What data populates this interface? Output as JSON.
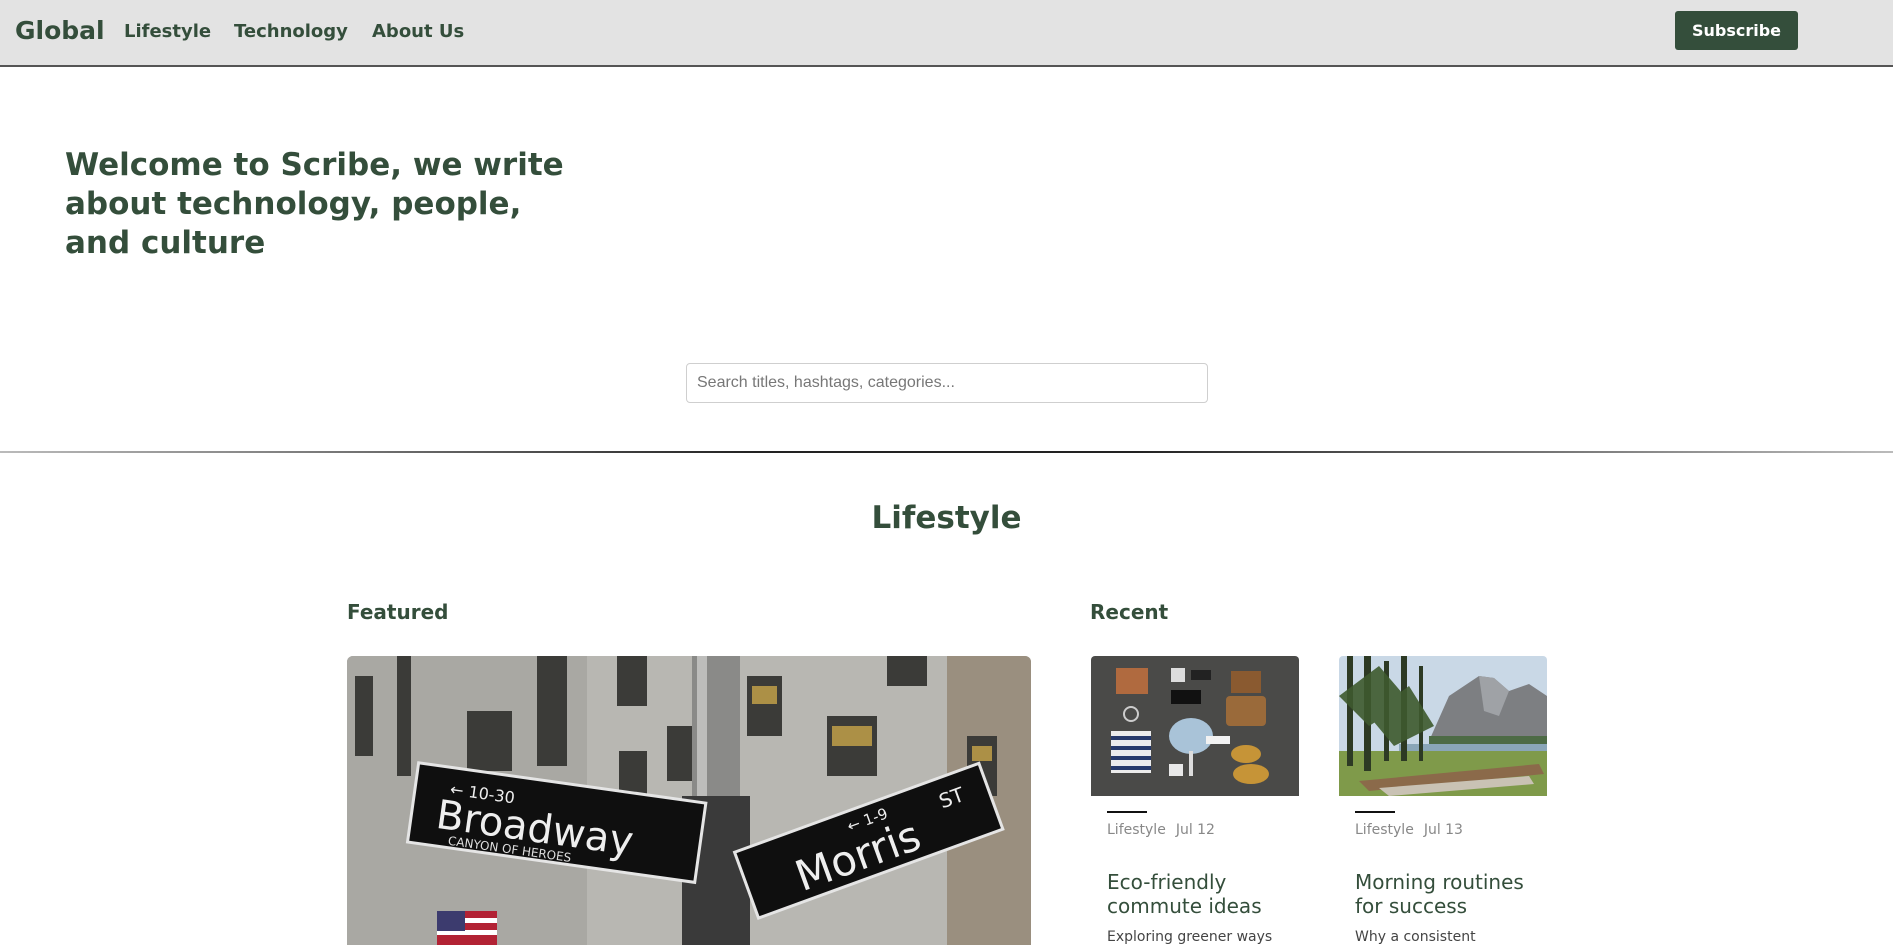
{
  "navbar": {
    "brand": "Global",
    "links": [
      "Lifestyle",
      "Technology",
      "About Us"
    ],
    "subscribe_label": "Subscribe"
  },
  "hero": {
    "title": "Welcome to Scribe, we write about technology, people, and culture",
    "search_placeholder": "Search titles, hashtags, categories..."
  },
  "section": {
    "title": "Lifestyle",
    "featured_label": "Featured",
    "recent_label": "Recent",
    "featured_image_signs": [
      "Broadway",
      "← 10-30",
      "CANYON OF HEROES",
      "Morris",
      "ST",
      "← 1-9"
    ],
    "cards": [
      {
        "category": "Lifestyle",
        "date": "Jul 12",
        "title": "Eco-friendly commute ideas",
        "excerpt": "Exploring greener ways"
      },
      {
        "category": "Lifestyle",
        "date": "Jul 13",
        "title": "Morning routines for success",
        "excerpt": "Why a consistent"
      }
    ]
  },
  "colors": {
    "primary": "#344e3b",
    "navbar_bg": "#e3e3e3",
    "muted_text": "#888888"
  }
}
